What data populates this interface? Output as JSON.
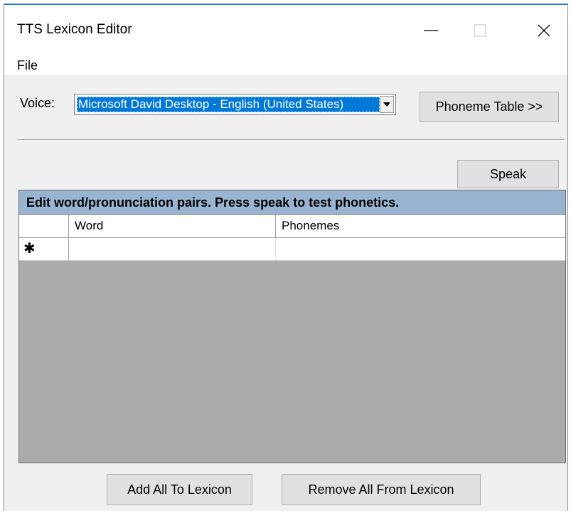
{
  "window": {
    "title": "TTS Lexicon Editor",
    "controls": {
      "minimize_icon": "minimize-icon",
      "maximize_icon": "maximize-icon",
      "close_icon": "close-icon"
    }
  },
  "menu": {
    "file": "File"
  },
  "voice": {
    "label": "Voice:",
    "selected": "Microsoft David Desktop - English (United States)",
    "dropdown_icon": "dropdown-arrow-icon"
  },
  "buttons": {
    "phoneme_table": "Phoneme Table >>",
    "speak": "Speak",
    "add_all": "Add All To Lexicon",
    "remove_all": "Remove All From Lexicon"
  },
  "grid": {
    "caption": "Edit word/pronunciation pairs.  Press speak to test phonetics.",
    "columns": [
      "Word",
      "Phonemes"
    ],
    "new_row_marker": "✱",
    "rows": []
  },
  "colors": {
    "accent_border": "#1e7ad6",
    "selection": "#0078d7",
    "caption_bg": "#99b4d1",
    "grid_bg": "#ababab",
    "window_bg": "#f0f0f0"
  }
}
